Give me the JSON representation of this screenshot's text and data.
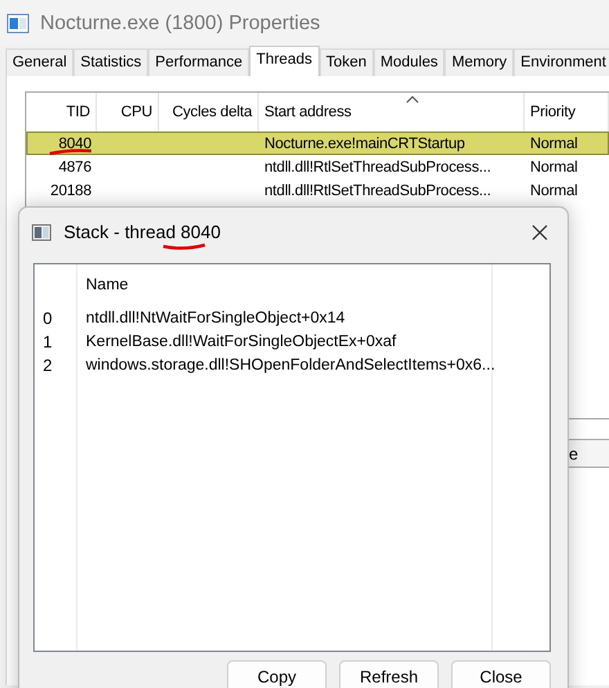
{
  "window": {
    "title": "Nocturne.exe (1800) Properties"
  },
  "tabs": [
    {
      "label": "General",
      "selected": false
    },
    {
      "label": "Statistics",
      "selected": false
    },
    {
      "label": "Performance",
      "selected": false
    },
    {
      "label": "Threads",
      "selected": true
    },
    {
      "label": "Token",
      "selected": false
    },
    {
      "label": "Modules",
      "selected": false
    },
    {
      "label": "Memory",
      "selected": false
    },
    {
      "label": "Environment",
      "selected": false
    }
  ],
  "threads": {
    "columns": [
      "TID",
      "CPU",
      "Cycles delta",
      "Start address",
      "Priority"
    ],
    "rows": [
      {
        "tid": "8040",
        "start_address": "Nocturne.exe!mainCRTStartup",
        "priority": "Normal",
        "selected": true
      },
      {
        "tid": "4876",
        "start_address": "ntdll.dll!RtlSetThreadSubProcess...",
        "priority": "Normal",
        "selected": false
      },
      {
        "tid": "20188",
        "start_address": "ntdll.dll!RtlSetThreadSubProcess...",
        "priority": "Normal",
        "selected": false
      }
    ]
  },
  "background_button": {
    "label": "e"
  },
  "stack_dialog": {
    "title": "Stack - thread ",
    "title_tid": "8040",
    "columns": [
      "Name"
    ],
    "frames": [
      {
        "index": "0",
        "name": "ntdll.dll!NtWaitForSingleObject+0x14"
      },
      {
        "index": "1",
        "name": "KernelBase.dll!WaitForSingleObjectEx+0xaf"
      },
      {
        "index": "2",
        "name": "windows.storage.dll!SHOpenFolderAndSelectItems+0x6..."
      }
    ],
    "buttons": [
      "Copy",
      "Refresh",
      "Close"
    ]
  }
}
